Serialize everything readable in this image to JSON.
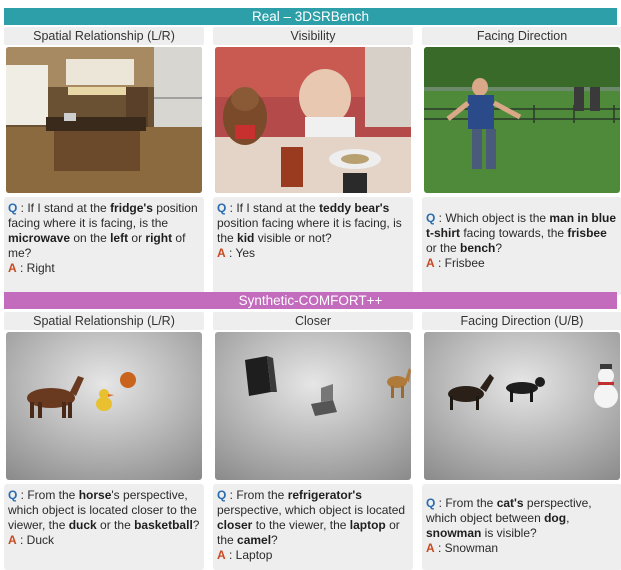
{
  "real": {
    "header": "Real – 3DSRBench",
    "columns": [
      {
        "title": "Spatial Relationship (L/R)",
        "q": [
          [
            "",
            " : If I stand at the "
          ],
          [
            "b",
            "fridge's"
          ],
          [
            "",
            " position facing where it is facing, is the "
          ],
          [
            "b",
            "microwave"
          ],
          [
            "",
            " on the "
          ],
          [
            "b",
            "left"
          ],
          [
            "",
            " or "
          ],
          [
            "b",
            "right"
          ],
          [
            "",
            " of me?"
          ]
        ],
        "a": " : Right"
      },
      {
        "title": "Visibility",
        "q": [
          [
            "",
            " : If I stand at the "
          ],
          [
            "b",
            "teddy bear's"
          ],
          [
            "",
            " position facing where it is facing, is the "
          ],
          [
            "b",
            "kid"
          ],
          [
            "",
            " visible or not?"
          ]
        ],
        "a": " : Yes"
      },
      {
        "title": "Facing Direction",
        "q": [
          [
            "",
            " : Which object is the "
          ],
          [
            "b",
            "man in blue t-shirt"
          ],
          [
            "",
            " facing towards, the "
          ],
          [
            "b",
            "frisbee"
          ],
          [
            "",
            " or the "
          ],
          [
            "b",
            "bench"
          ],
          [
            "",
            "?"
          ]
        ],
        "a": " : Frisbee"
      }
    ]
  },
  "synthetic": {
    "header": "Synthetic-COMFORT++",
    "columns": [
      {
        "title": "Spatial Relationship (L/R)",
        "q": [
          [
            "",
            " : From the "
          ],
          [
            "b",
            "horse"
          ],
          [
            "",
            "'s perspective, which object is located closer to the viewer, the "
          ],
          [
            "b",
            "duck"
          ],
          [
            "",
            " or the "
          ],
          [
            "b",
            "basketball"
          ],
          [
            "",
            "?"
          ]
        ],
        "a": " : Duck"
      },
      {
        "title": "Closer",
        "q": [
          [
            "",
            " : From the "
          ],
          [
            "b",
            "refrigerator's"
          ],
          [
            "",
            " perspective, which object is located "
          ],
          [
            "b",
            "closer"
          ],
          [
            "",
            " to the viewer, the "
          ],
          [
            "b",
            "laptop"
          ],
          [
            "",
            " or the "
          ],
          [
            "b",
            "camel"
          ],
          [
            "",
            "?"
          ]
        ],
        "a": " : Laptop"
      },
      {
        "title": "Facing Direction (U/B)",
        "q": [
          [
            "",
            " : From the "
          ],
          [
            "b",
            "cat's"
          ],
          [
            "",
            " perspective, which object between "
          ],
          [
            "b",
            "dog"
          ],
          [
            "",
            ", "
          ],
          [
            "b",
            "snowman"
          ],
          [
            "",
            " is visible?"
          ]
        ],
        "a": " : Snowman"
      }
    ]
  },
  "labels": {
    "q": "Q",
    "a": "A"
  },
  "colors": {
    "real_banner": "#2c9fa8",
    "synthetic_banner": "#c36bbd",
    "q_label": "#2b6cb0",
    "a_label": "#c84a22"
  }
}
